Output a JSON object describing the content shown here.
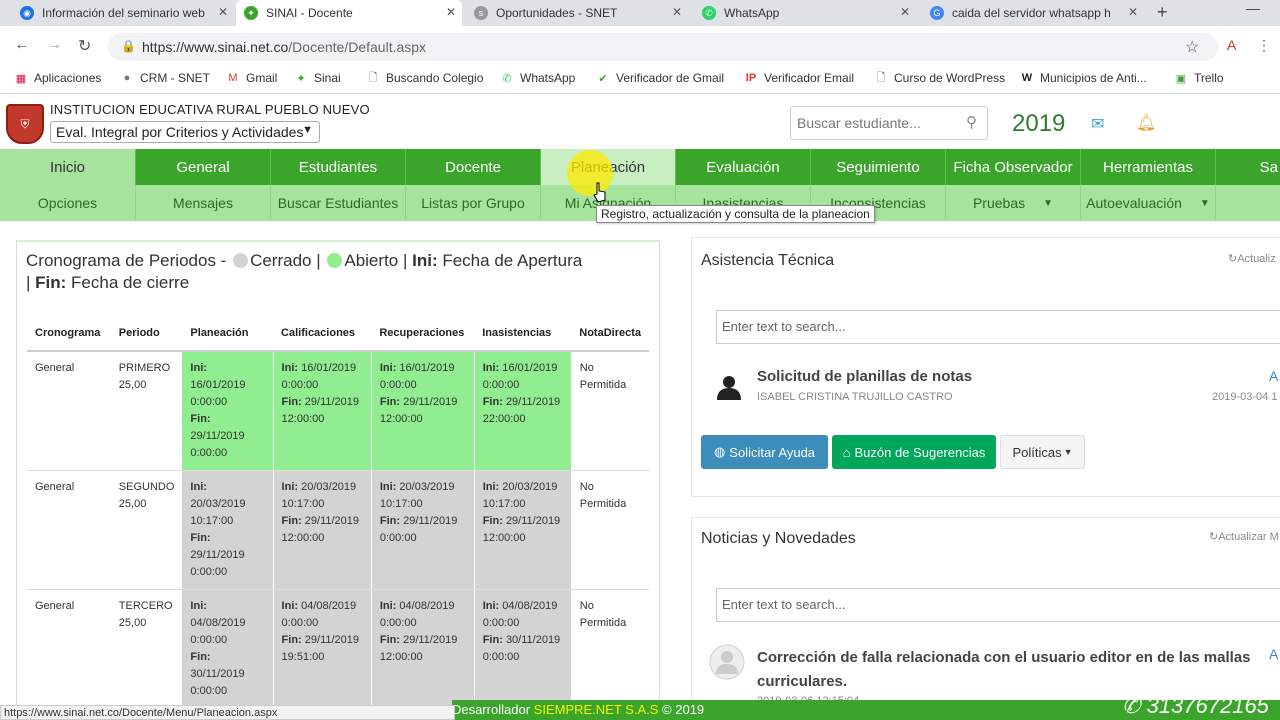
{
  "browser": {
    "tabs": [
      {
        "label": "Información del seminario web",
        "active": false,
        "color": "#1a73e8"
      },
      {
        "label": "SINAI - Docente",
        "active": true,
        "color": "#3aa52a"
      },
      {
        "label": "Oportunidades - SNET",
        "active": false,
        "color": "#999999"
      },
      {
        "label": "WhatsApp",
        "active": false,
        "color": "#25d366"
      },
      {
        "label": "caida del servidor whatsapp h",
        "active": false,
        "color": "#4285f4"
      }
    ],
    "url_prefix": "https://www.sinai.net.co",
    "url_path": "/Docente/Default.aspx",
    "bookmarks": [
      "Aplicaciones",
      "CRM - SNET",
      "Gmail",
      "Sinai",
      "Buscando Colegio",
      "WhatsApp",
      "Verificador de Gmail",
      "Verificador Email",
      "Curso de WordPress",
      "Municipios de Anti...",
      "Trello"
    ]
  },
  "header": {
    "institution": "INSTITUCION EDUCATIVA RURAL PUEBLO NUEVO",
    "evaluation": "Eval. Integral por Criterios y Actividades",
    "search_placeholder": "Buscar estudiante...",
    "year": "2019"
  },
  "menu_main": [
    "Inicio",
    "General",
    "Estudiantes",
    "Docente",
    "Planeación",
    "Evaluación",
    "Seguimiento",
    "Ficha Observador",
    "Herramientas",
    "Sa"
  ],
  "menu_sub": [
    "Opciones",
    "Mensajes",
    "Buscar Estudiantes",
    "Listas por Grupo",
    "Mi Asignación",
    "Inasistencias",
    "Inconsistencias",
    "Pruebas",
    "Autoevaluación"
  ],
  "tooltip": "Registro, actualización y consulta de la planeacion",
  "cronograma": {
    "title_start": "Cronograma de Periodos -",
    "cerrado": "Cerrado |",
    "abierto": "Abierto |",
    "ini_label": "Ini:",
    "ini_text": "Fecha de Apertura",
    "sep": "|",
    "fin_label": "Fin:",
    "fin_text": "Fecha de cierre",
    "headers": [
      "Cronograma",
      "Periodo",
      "Planeación",
      "Calificaciones",
      "Recuperaciones",
      "Inasistencias",
      "NotaDirecta"
    ],
    "rows": [
      {
        "cronograma": "General",
        "periodo": "PRIMERO",
        "peso": "25,00",
        "planeacion_ini": "16/01/2019 0:00:00",
        "planeacion_fin": "29/11/2019 0:00:00",
        "calificaciones_ini": "16/01/2019 0:00:00",
        "calificaciones_fin": "29/11/2019 12:00:00",
        "recuperaciones_ini": "16/01/2019 0:00:00",
        "recuperaciones_fin": "29/11/2019 12:00:00",
        "inasistencias_ini": "16/01/2019 0:00:00",
        "inasistencias_fin": "29/11/2019 22:00:00",
        "nota": "No Permitida",
        "estado": "abierto"
      },
      {
        "cronograma": "General",
        "periodo": "SEGUNDO",
        "peso": "25,00",
        "planeacion_ini": "20/03/2019 10:17:00",
        "planeacion_fin": "29/11/2019 0:00:00",
        "calificaciones_ini": "20/03/2019 10:17:00",
        "calificaciones_fin": "29/11/2019 12:00:00",
        "recuperaciones_ini": "20/03/2019 10:17:00",
        "recuperaciones_fin": "29/11/2019 0:00:00",
        "inasistencias_ini": "20/03/2019 10:17:00",
        "inasistencias_fin": "29/11/2019 12:00:00",
        "nota": "No Permitida",
        "estado": "cerrado"
      },
      {
        "cronograma": "General",
        "periodo": "TERCERO",
        "peso": "25,00",
        "planeacion_ini": "04/08/2019 0:00:00",
        "planeacion_fin": "30/11/2019 0:00:00",
        "calificaciones_ini": "04/08/2019 0:00:00",
        "calificaciones_fin": "29/11/2019 19:51:00",
        "recuperaciones_ini": "04/08/2019 0:00:00",
        "recuperaciones_fin": "29/11/2019 12:00:00",
        "inasistencias_ini": "04/08/2019 0:00:00",
        "inasistencias_fin": "30/11/2019 0:00:00",
        "nota": "No Permitida",
        "estado": "cerrado"
      }
    ]
  },
  "asistencia": {
    "title": "Asistencia Técnica",
    "refresh": "Actualiz",
    "search_placeholder": "Enter text to search...",
    "item_title": "Solicitud de planillas de notas",
    "item_author": "ISABEL CRISTINA TRUJILLO CASTRO",
    "item_date": "2019-03-04 1",
    "item_letter": "A",
    "btn_ayuda": "Solicitar Ayuda",
    "btn_buzon": "Buzón de Sugerencias",
    "btn_politicas": "Políticas"
  },
  "noticias": {
    "title": "Noticias y Novedades",
    "refresh": "Actualizar M",
    "search_placeholder": "Enter text to search...",
    "item_title": "Corrección de falla relacionada con el usuario editor en de las mallas curriculares.",
    "item_letter": "A",
    "item_date": "2019-03-06 12:15:04"
  },
  "statusbar": "https://www.sinai.net.co/Docente/Menu/Planeacion.aspx",
  "footer": {
    "dev_label": "Desarrollador",
    "dev_name": "SIEMPRE.NET S.A.S",
    "copyright": "© 2019",
    "phone": "3137672165"
  },
  "colors": {
    "green": "#3aa52a",
    "light_green": "#a6e39c",
    "open": "#90ee90",
    "closed": "#d3d3d3",
    "help_blue": "#3c8dbc",
    "buzon_green": "#00a65a"
  }
}
